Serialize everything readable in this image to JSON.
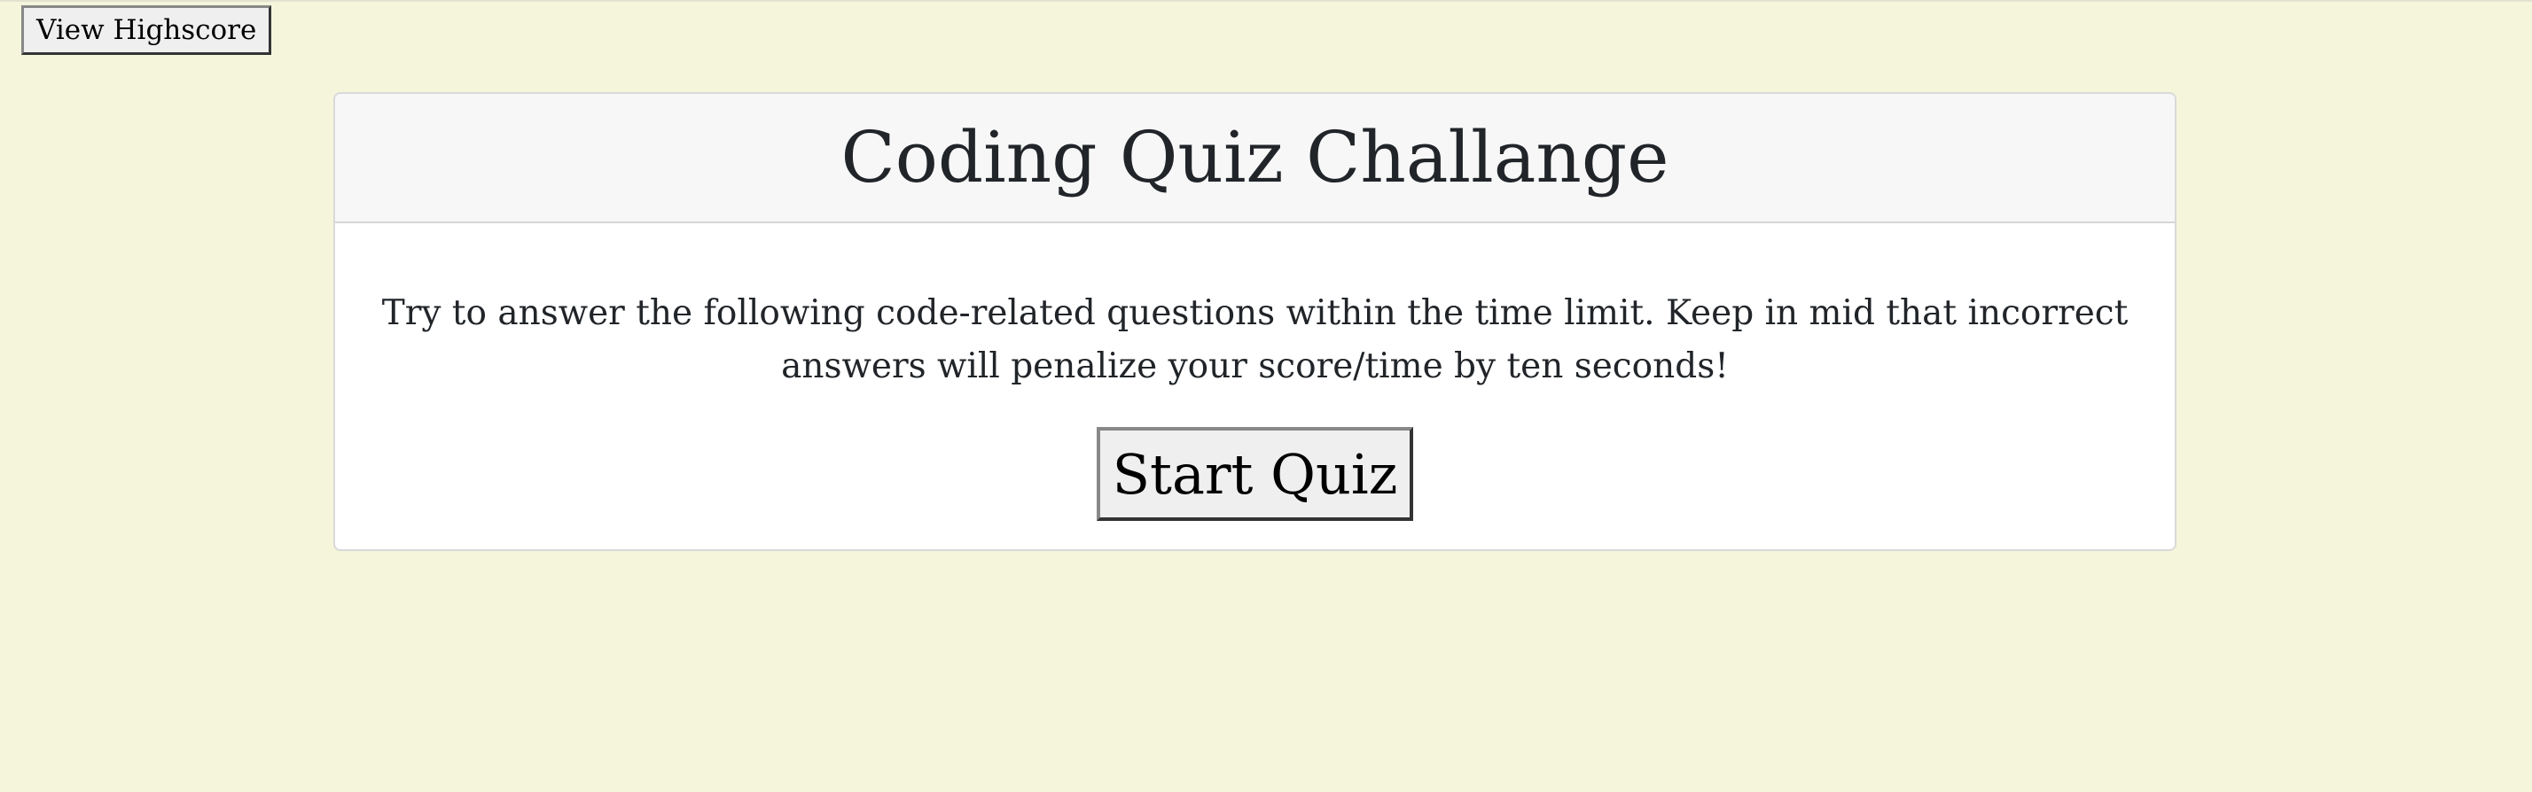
{
  "header": {
    "highscore_label": "View Highscore"
  },
  "card": {
    "title": "Coding Quiz Challange",
    "instructions": "Try to answer the following code-related questions within the time limit. Keep in mid that incorrect answers will penalize your score/time by ten seconds!",
    "start_label": "Start Quiz"
  },
  "colors": {
    "page_background": "#f5f5dc",
    "card_background": "#ffffff",
    "card_header_background": "#f7f7f7",
    "text": "#212529",
    "button_background": "#efefef"
  }
}
